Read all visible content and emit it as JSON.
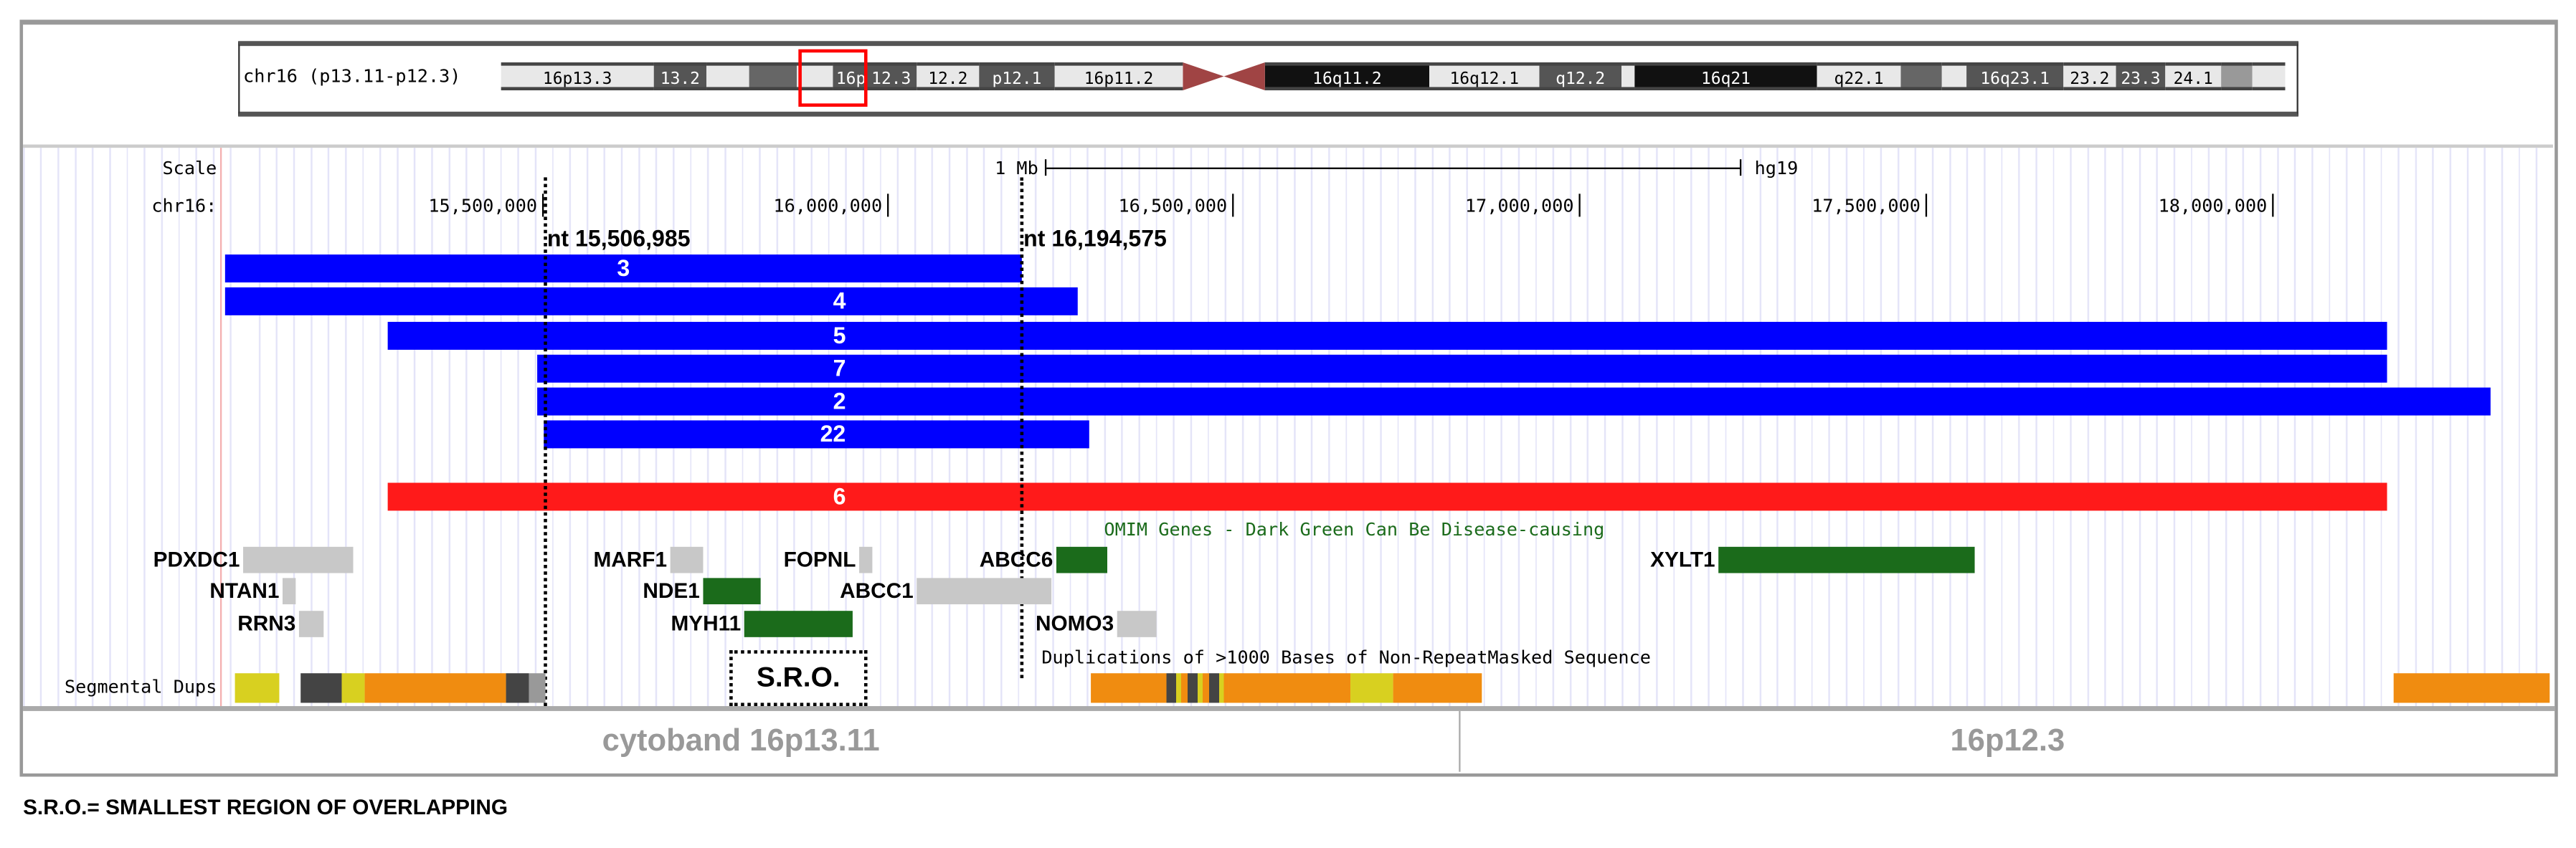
{
  "ideogram": {
    "label": "chr16 (p13.11-p12.3)",
    "bands": [
      "16p13.3",
      "13.2",
      "16p",
      "12.3",
      "12.2",
      "p12.1",
      "16p11.2",
      "16q11.2",
      "16q12.1",
      "q12.2",
      "16q21",
      "q22.1",
      "16q23.1",
      "23.2",
      "23.3",
      "24.1"
    ]
  },
  "scale": {
    "label": "Scale",
    "chrom": "chr16:",
    "size": "1 Mb",
    "assembly": "hg19",
    "ticks": [
      "15,500,000",
      "16,000,000",
      "16,500,000",
      "17,000,000",
      "17,500,000",
      "18,000,000"
    ]
  },
  "markers": {
    "left": "nt 15,506,985",
    "right": "nt 16,194,575"
  },
  "cnvs": [
    "3",
    "4",
    "5",
    "7",
    "2",
    "22",
    "6"
  ],
  "omim_title": "OMIM Genes - Dark Green Can Be Disease-causing",
  "genes": [
    "PDXDC1",
    "NTAN1",
    "RRN3",
    "MARF1",
    "FOPNL",
    "ABCC6",
    "XYLT1",
    "NDE1",
    "ABCC1",
    "MYH11",
    "NOMO3"
  ],
  "dups_title": "Duplications of >1000 Bases of Non-RepeatMasked Sequence",
  "segdups_label": "Segmental Dups",
  "sro": "S.R.O.",
  "cytobands": {
    "left": "cytoband 16p13.11",
    "right": "16p12.3"
  },
  "footer": "S.R.O.= SMALLEST REGION OF OVERLAPPING"
}
